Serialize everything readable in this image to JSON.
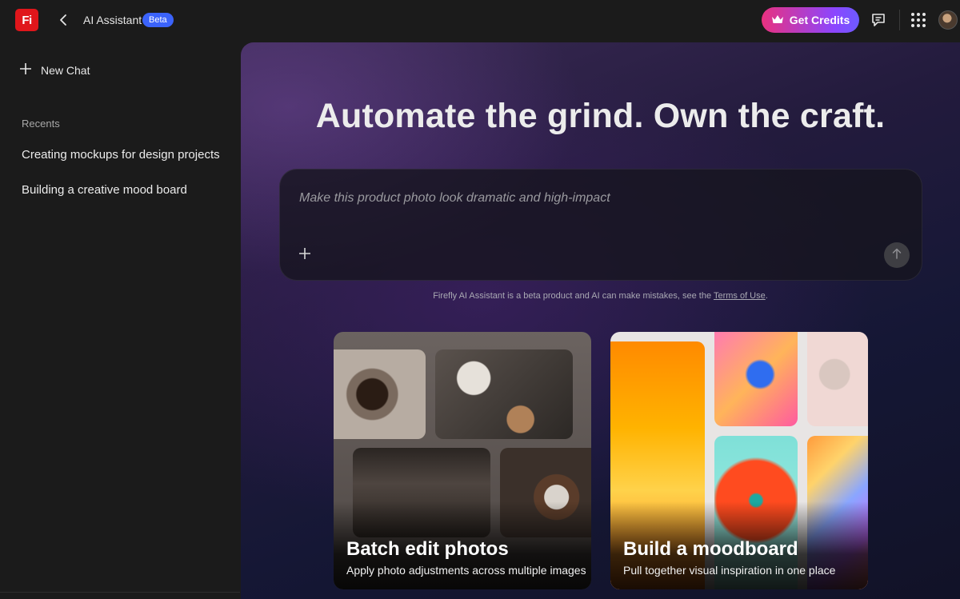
{
  "app": {
    "logo_text": "Fi",
    "title": "AI Assistant",
    "badge": "Beta",
    "brand_color": "#e0161b",
    "badge_color": "#3b63fb"
  },
  "header": {
    "credits_label": "Get Credits",
    "credits_icon": "crown-icon",
    "icons": [
      "back-icon",
      "feedback-icon",
      "apps-grid-icon",
      "user-avatar"
    ]
  },
  "sidebar": {
    "new_chat_label": "New Chat",
    "recents_label": "Recents",
    "recents": [
      {
        "label": "Creating mockups for design projects"
      },
      {
        "label": "Building a creative mood board"
      }
    ]
  },
  "main": {
    "headline": "Automate the grind. Own the craft.",
    "prompt": {
      "value": "",
      "placeholder": "Make this product photo look dramatic and high-impact"
    },
    "disclaimer_text": "Firefly AI Assistant is a beta product and AI can make mistakes, see the ",
    "disclaimer_link": "Terms of Use",
    "disclaimer_end": ".",
    "cards": [
      {
        "title": "Batch edit photos",
        "subtitle": "Apply photo adjustments across multiple images"
      },
      {
        "title": "Build a moodboard",
        "subtitle": "Pull together visual inspiration in one place"
      }
    ]
  }
}
